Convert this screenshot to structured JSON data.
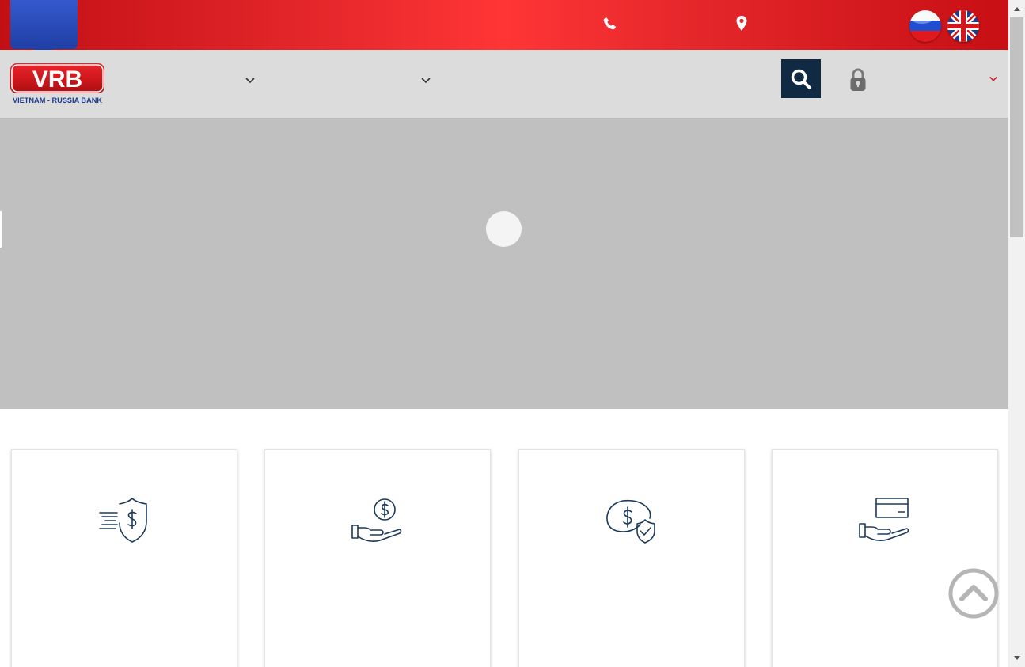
{
  "brand": {
    "logo_text": "VRB",
    "logo_subtitle": "VIETNAM - RUSSIA BANK",
    "primary_color": "#d0181d",
    "accent_color": "#1f3fa6",
    "navy_color": "#102a43"
  },
  "topbar": {
    "icons": [
      "phone-icon",
      "location-pin-icon"
    ],
    "languages": [
      "russian-flag",
      "english-flag"
    ]
  },
  "navbar": {
    "icons": [
      "chevron-down-icon",
      "search-icon",
      "lock-icon"
    ]
  },
  "hero": {
    "slider_state": "loading"
  },
  "cards": [
    {
      "icon": "shield-dollar-icon"
    },
    {
      "icon": "hand-coin-icon"
    },
    {
      "icon": "dollar-shield-check-icon"
    },
    {
      "icon": "hand-card-icon"
    }
  ],
  "scroll_to_top": {
    "icon": "chevron-up-circle-icon"
  }
}
